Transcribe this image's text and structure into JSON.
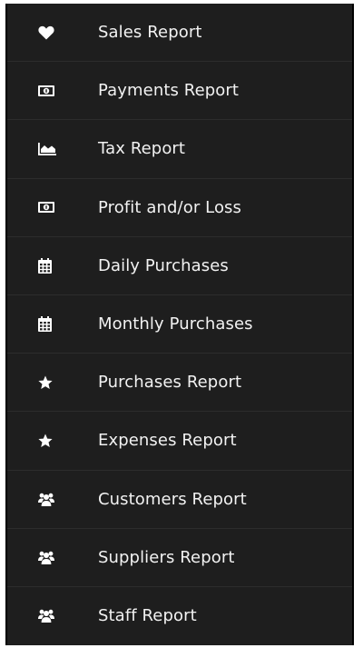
{
  "menu": {
    "items": [
      {
        "label": "Sales Report",
        "icon": "heart-icon"
      },
      {
        "label": "Payments Report",
        "icon": "money-icon"
      },
      {
        "label": "Tax Report",
        "icon": "area-chart-icon"
      },
      {
        "label": "Profit and/or Loss",
        "icon": "money-icon"
      },
      {
        "label": "Daily Purchases",
        "icon": "calendar-icon"
      },
      {
        "label": "Monthly Purchases",
        "icon": "calendar-icon"
      },
      {
        "label": "Purchases Report",
        "icon": "star-icon"
      },
      {
        "label": "Expenses Report",
        "icon": "star-icon"
      },
      {
        "label": "Customers Report",
        "icon": "users-icon"
      },
      {
        "label": "Suppliers Report",
        "icon": "users-icon"
      },
      {
        "label": "Staff Report",
        "icon": "users-icon"
      }
    ]
  },
  "colors": {
    "background": "#1e1e1e",
    "divider": "#2c2c2c",
    "text": "#f2f2f2",
    "icon": "#ffffff"
  }
}
